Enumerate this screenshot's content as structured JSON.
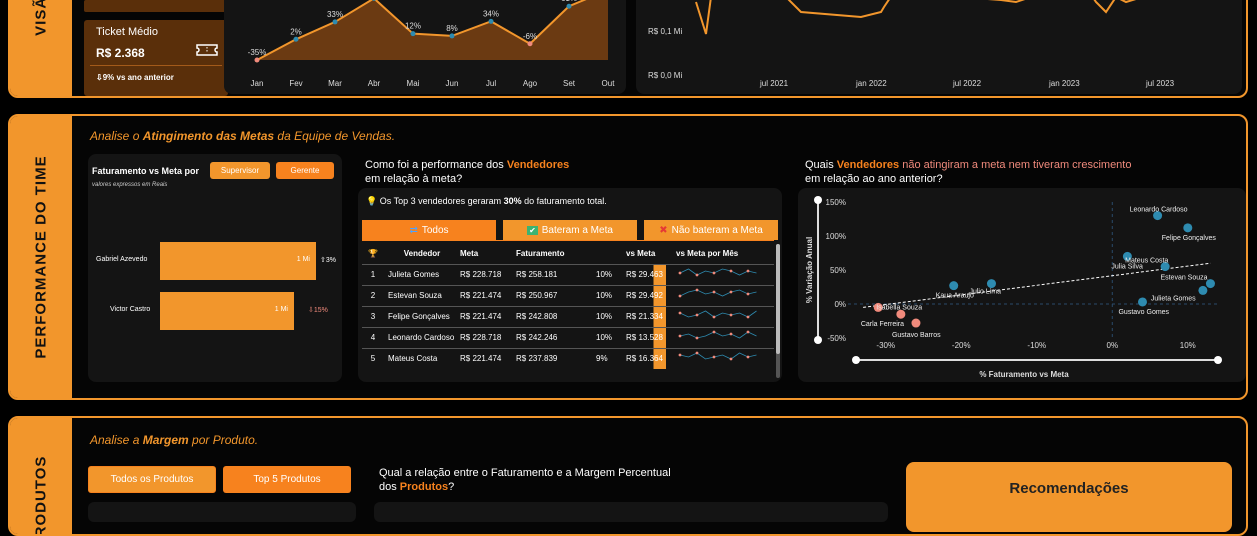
{
  "top_section": {
    "side_label": "VISÃO",
    "kpi": {
      "title": "Ticket Médio",
      "value": "R$ 2.368",
      "delta": "⇩9% vs ano anterior"
    },
    "monthly_chart": {
      "months": [
        "Jan",
        "Fev",
        "Mar",
        "Abr",
        "Mai",
        "Jun",
        "Jul",
        "Ago",
        "Set",
        "Out"
      ],
      "labels": [
        "-35%",
        "2%",
        "33%",
        "",
        "12%",
        "8%",
        "34%",
        "-6%",
        "61%",
        ""
      ]
    },
    "trend_chart": {
      "y_ticks": [
        "R$ 0,1 Mi",
        "R$ 0,0 Mi"
      ],
      "x_ticks": [
        "jul 2021",
        "jan 2022",
        "jul 2022",
        "jan 2023",
        "jul 2023"
      ]
    }
  },
  "performance": {
    "side_label": "PERFORMANCE DO TIME",
    "subtitle_pre": "Analise o ",
    "subtitle_bold": "Atingimento das Metas",
    "subtitle_post": " da Equipe de Vendas.",
    "fat_meta": {
      "title": "Faturamento vs Meta por",
      "btn_supervisor": "Supervisor",
      "btn_gerente": "Gerente",
      "note": "valores expressos em Reais",
      "rows": [
        {
          "name": "Gabriel Azevedo",
          "bar_label": "1 Mi",
          "delta": "⇧3%",
          "fill": 1.0
        },
        {
          "name": "Victor Castro",
          "bar_label": "1 Mi",
          "delta": "⇩15%",
          "fill": 0.86
        }
      ]
    },
    "vendedores": {
      "title_pre": "Como foi a performance dos ",
      "title_hl": "Vendedores",
      "title_line2": "em relação à meta?",
      "insight_icon": "lightbulb-icon",
      "insight_pre": "Os Top 3 vendedores geraram ",
      "insight_bold": "30%",
      "insight_post": " do faturamento total.",
      "tabs": [
        "Todos",
        "Bateram a Meta",
        "Não bateram a Meta"
      ],
      "tab_icons": [
        "⇄",
        "✔",
        "✖"
      ],
      "columns": [
        "Vendedor",
        "Meta",
        "Faturamento",
        "",
        "vs Meta",
        "vs Meta por Mês"
      ],
      "rows": [
        {
          "rank": "1",
          "name": "Julieta Gomes",
          "meta": "R$ 228.718",
          "fat": "R$ 258.181",
          "pct": "10%",
          "vsmeta": "R$ 29.463"
        },
        {
          "rank": "2",
          "name": "Estevan Souza",
          "meta": "R$ 221.474",
          "fat": "R$ 250.967",
          "pct": "10%",
          "vsmeta": "R$ 29.492"
        },
        {
          "rank": "3",
          "name": "Felipe Gonçalves",
          "meta": "R$ 221.474",
          "fat": "R$ 242.808",
          "pct": "10%",
          "vsmeta": "R$ 21.334"
        },
        {
          "rank": "4",
          "name": "Leonardo Cardoso",
          "meta": "R$ 228.718",
          "fat": "R$ 242.246",
          "pct": "10%",
          "vsmeta": "R$ 13.528"
        },
        {
          "rank": "5",
          "name": "Mateus Costa",
          "meta": "R$ 221.474",
          "fat": "R$ 237.839",
          "pct": "9%",
          "vsmeta": "R$ 16.364"
        }
      ]
    },
    "scatter": {
      "title_pre": "Quais ",
      "title_hl": "Vendedores",
      "title_pk": " não atingiram a meta nem tiveram crescimento",
      "title_line2": "em relação ao ano anterior?",
      "xlabel": "% Faturamento vs Meta",
      "ylabel": "% Variação Anual",
      "y_ticks": [
        "150%",
        "100%",
        "50%",
        "0%",
        "-50%"
      ],
      "x_ticks": [
        "-30%",
        "-20%",
        "-10%",
        "0%",
        "10%"
      ]
    }
  },
  "produtos": {
    "side_label": "PRODUTOS",
    "subtitle_pre": "Analise a ",
    "subtitle_bold": "Margem",
    "subtitle_post": " por Produto.",
    "btn_todos": "Todos os Produtos",
    "btn_top5": "Top 5 Produtos",
    "question_line1": "Qual a relação entre o Faturamento e a Margem Percentual",
    "question_pre": "dos ",
    "question_hl": "Produtos",
    "question_post": "?",
    "recomendacoes": "Recomendações"
  },
  "chart_data": [
    {
      "type": "area",
      "categories": [
        "Jan",
        "Fev",
        "Mar",
        "Abr",
        "Mai",
        "Jun",
        "Jul",
        "Ago",
        "Set",
        "Out"
      ],
      "series": [
        {
          "values": [
            -35,
            2,
            33,
            75,
            12,
            8,
            34,
            -6,
            61,
            90
          ]
        }
      ]
    },
    {
      "type": "scatter",
      "xlabel": "% Faturamento vs Meta",
      "ylabel": "% Variação Anual",
      "xlim": [
        -35,
        14
      ],
      "ylim": [
        -50,
        150
      ],
      "points": [
        {
          "name": "Leonardo Cardoso",
          "x": 6,
          "y": 130,
          "hit": true
        },
        {
          "name": "Felipe Gonçalves",
          "x": 10,
          "y": 112,
          "hit": true
        },
        {
          "name": "Julia Silva",
          "x": 2,
          "y": 70,
          "hit": true
        },
        {
          "name": "Mateus Costa",
          "x": 7,
          "y": 55,
          "hit": true
        },
        {
          "name": "Estevan Souza",
          "x": 13,
          "y": 30,
          "hit": true
        },
        {
          "name": "Julieta Gomes",
          "x": 12,
          "y": 20,
          "hit": true
        },
        {
          "name": "Gustavo Gomes",
          "x": 4,
          "y": 3,
          "hit": true
        },
        {
          "name": "Kaua Araujo",
          "x": -21,
          "y": 27,
          "hit": true
        },
        {
          "name": "Julio Lima",
          "x": -16,
          "y": 30,
          "hit": true
        },
        {
          "name": "Isabella Souza",
          "x": -31,
          "y": -5,
          "hit": false
        },
        {
          "name": "Carla Ferreira",
          "x": -28,
          "y": -15,
          "hit": false
        },
        {
          "name": "Gustavo Barros",
          "x": -26,
          "y": -28,
          "hit": false
        }
      ]
    }
  ]
}
